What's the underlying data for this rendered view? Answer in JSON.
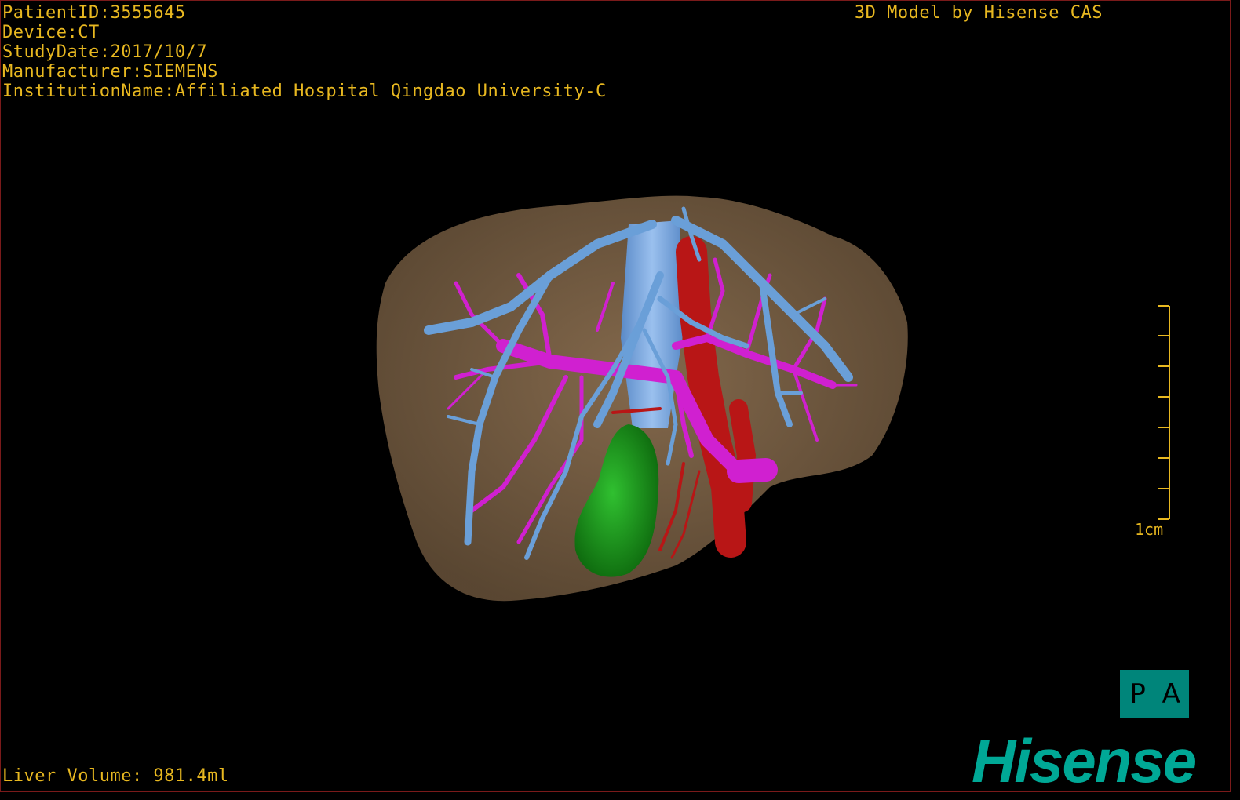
{
  "info": {
    "patient_id": "PatientID:3555645",
    "device": "Device:CT",
    "study_date": "StudyDate:2017/10/7",
    "manufacturer": "Manufacturer:SIEMENS",
    "institution": "InstitutionName:Affiliated Hospital Qingdao University-C"
  },
  "title": "3D Model by Hisense CAS",
  "liver_volume": "Liver Volume: 981.4ml",
  "scale": {
    "label": "1cm",
    "ticks": 8
  },
  "orientation": {
    "left": "P",
    "right": "A"
  },
  "brand": "Hisense",
  "colors": {
    "text": "#e8b820",
    "liver": "#7a6045",
    "hepatic_vein": "#6a9fd8",
    "portal_vein": "#d020d0",
    "artery": "#c01818",
    "gallbladder": "#1a9a1a",
    "brand": "#00a896"
  }
}
